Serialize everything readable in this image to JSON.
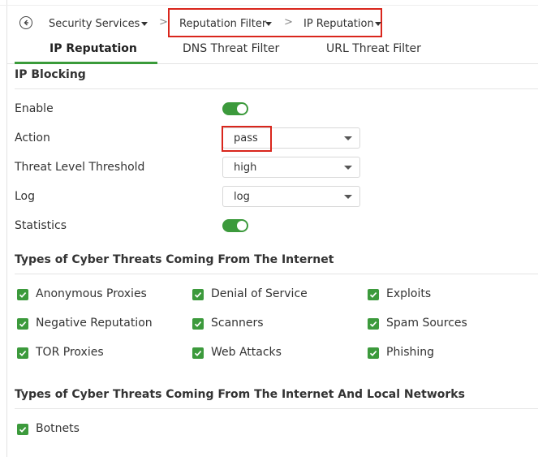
{
  "breadcrumb": {
    "items": [
      "Security Services",
      "Reputation Filter",
      "IP Reputation"
    ],
    "separator": ">"
  },
  "tabs": [
    {
      "label": "IP Reputation",
      "active": true
    },
    {
      "label": "DNS Threat Filter",
      "active": false
    },
    {
      "label": "URL Threat Filter",
      "active": false
    }
  ],
  "ip_blocking": {
    "title": "IP Blocking",
    "enable": {
      "label": "Enable",
      "checked": true
    },
    "action": {
      "label": "Action",
      "value": "pass"
    },
    "threshold": {
      "label": "Threat Level Threshold",
      "value": "high"
    },
    "log": {
      "label": "Log",
      "value": "log"
    },
    "statistics": {
      "label": "Statistics",
      "checked": true
    }
  },
  "internet_threats": {
    "title": "Types of Cyber Threats Coming From The Internet",
    "items": [
      {
        "label": "Anonymous Proxies",
        "checked": true
      },
      {
        "label": "Denial of Service",
        "checked": true
      },
      {
        "label": "Exploits",
        "checked": true
      },
      {
        "label": "Negative Reputation",
        "checked": true
      },
      {
        "label": "Scanners",
        "checked": true
      },
      {
        "label": "Spam Sources",
        "checked": true
      },
      {
        "label": "TOR Proxies",
        "checked": true
      },
      {
        "label": "Web Attacks",
        "checked": true
      },
      {
        "label": "Phishing",
        "checked": true
      }
    ]
  },
  "local_threats": {
    "title": "Types of Cyber Threats Coming From The Internet And Local Networks",
    "items": [
      {
        "label": "Botnets",
        "checked": true
      }
    ]
  },
  "colors": {
    "accent_green": "#3c9a3c",
    "highlight_red": "#d9261c"
  }
}
